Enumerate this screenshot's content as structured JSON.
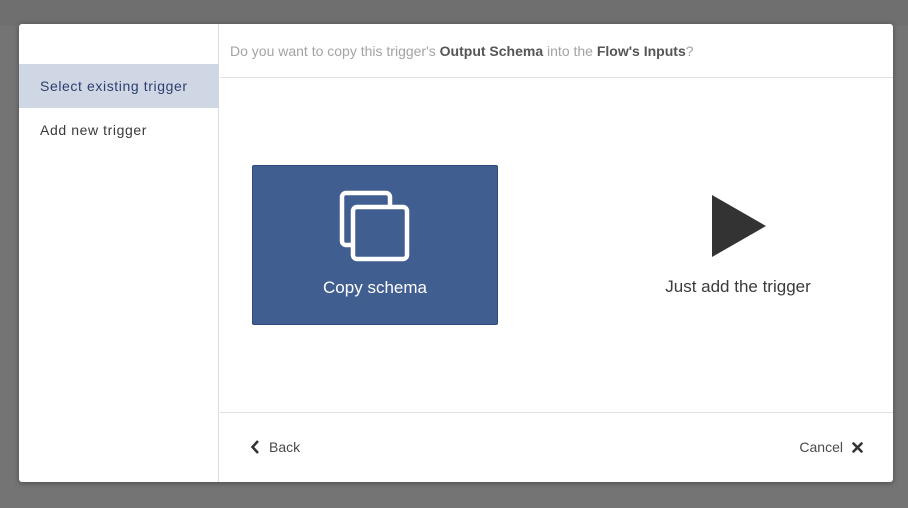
{
  "sidebar": {
    "items": [
      {
        "label": "Select existing trigger",
        "active": true
      },
      {
        "label": "Add new trigger",
        "active": false
      }
    ]
  },
  "question": {
    "prefix": "Do you want to copy this trigger's ",
    "emphasis1": "Output Schema",
    "middle": " into the ",
    "emphasis2": "Flow's Inputs",
    "suffix": "?"
  },
  "options": {
    "copy_label": "Copy schema",
    "copy_icon": "copy-icon",
    "trigger_label": "Just add the trigger",
    "trigger_icon": "play-icon"
  },
  "footer": {
    "back_label": "Back",
    "cancel_label": "Cancel"
  },
  "colors": {
    "accent": "#415e91",
    "sidebar_active_bg": "#cfd6e4",
    "sidebar_active_text": "#2d3f6e",
    "backdrop": "#747474"
  }
}
